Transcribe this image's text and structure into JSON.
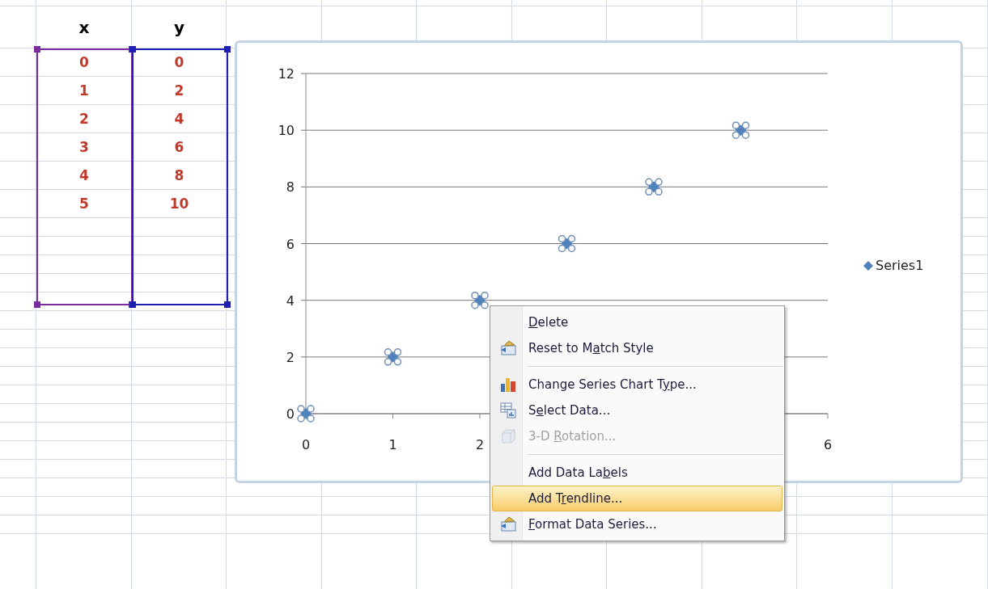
{
  "table": {
    "columns": [
      {
        "header": "x",
        "color": "#7b2c9f",
        "values": [
          "0",
          "1",
          "2",
          "3",
          "4",
          "5"
        ]
      },
      {
        "header": "y",
        "color": "#1f1fb4",
        "values": [
          "0",
          "2",
          "4",
          "6",
          "8",
          "10"
        ]
      }
    ]
  },
  "chart": {
    "chart_data": {
      "type": "scatter",
      "x": [
        0,
        1,
        2,
        3,
        4,
        5
      ],
      "series": [
        {
          "name": "Series1",
          "color": "#4f81bd",
          "values": [
            0,
            2,
            4,
            6,
            8,
            10
          ]
        }
      ],
      "xlim": [
        0,
        6
      ],
      "ylim": [
        0,
        12
      ],
      "xticks": [
        0,
        1,
        2,
        6
      ],
      "yticks": [
        0,
        2,
        4,
        6,
        8,
        10,
        12
      ],
      "grid": true
    },
    "series_selected": true
  },
  "context_menu": {
    "items": [
      {
        "kind": "item",
        "key": "D",
        "after": "elete",
        "disabled": false,
        "selected": false
      },
      {
        "kind": "item",
        "before": "Reset to M",
        "key": "a",
        "after": "tch Style",
        "disabled": false,
        "selected": false
      },
      {
        "kind": "separator"
      },
      {
        "kind": "item",
        "before": "Change Series Chart T",
        "key": "y",
        "after": "pe...",
        "disabled": false,
        "selected": false
      },
      {
        "kind": "item",
        "before": "S",
        "key": "e",
        "after": "lect Data...",
        "disabled": false,
        "selected": false
      },
      {
        "kind": "item",
        "before": "3-D ",
        "key": "R",
        "after": "otation...",
        "disabled": true,
        "selected": false
      },
      {
        "kind": "separator"
      },
      {
        "kind": "item",
        "before": "Add Data La",
        "key": "b",
        "after": "els",
        "disabled": false,
        "selected": false
      },
      {
        "kind": "item",
        "before": "Add T",
        "key": "r",
        "after": "endline...",
        "disabled": false,
        "selected": true
      },
      {
        "kind": "item",
        "key": "F",
        "after": "ormat Data Series...",
        "disabled": false,
        "selected": false
      }
    ]
  }
}
